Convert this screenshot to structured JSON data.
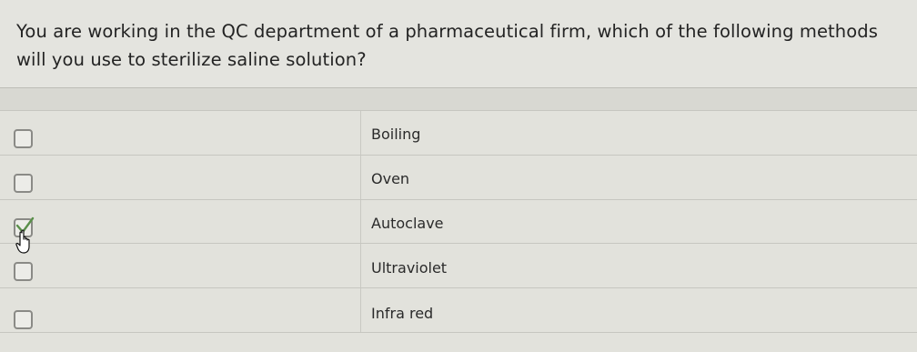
{
  "question": {
    "text": "You are working in the QC department of a pharmaceutical firm, which of the following methods will you use to sterilize saline solution?"
  },
  "options": [
    {
      "label": "Boiling",
      "checked": false
    },
    {
      "label": "Oven",
      "checked": false
    },
    {
      "label": "Autoclave",
      "checked": true
    },
    {
      "label": "Ultraviolet",
      "checked": false
    },
    {
      "label": "Infra red",
      "checked": false
    }
  ],
  "icons": {
    "check": "check-icon",
    "cursor": "hand-pointer-icon"
  },
  "colors": {
    "check_mark": "#5a8f4a",
    "checkbox_border": "#8a8a86"
  }
}
